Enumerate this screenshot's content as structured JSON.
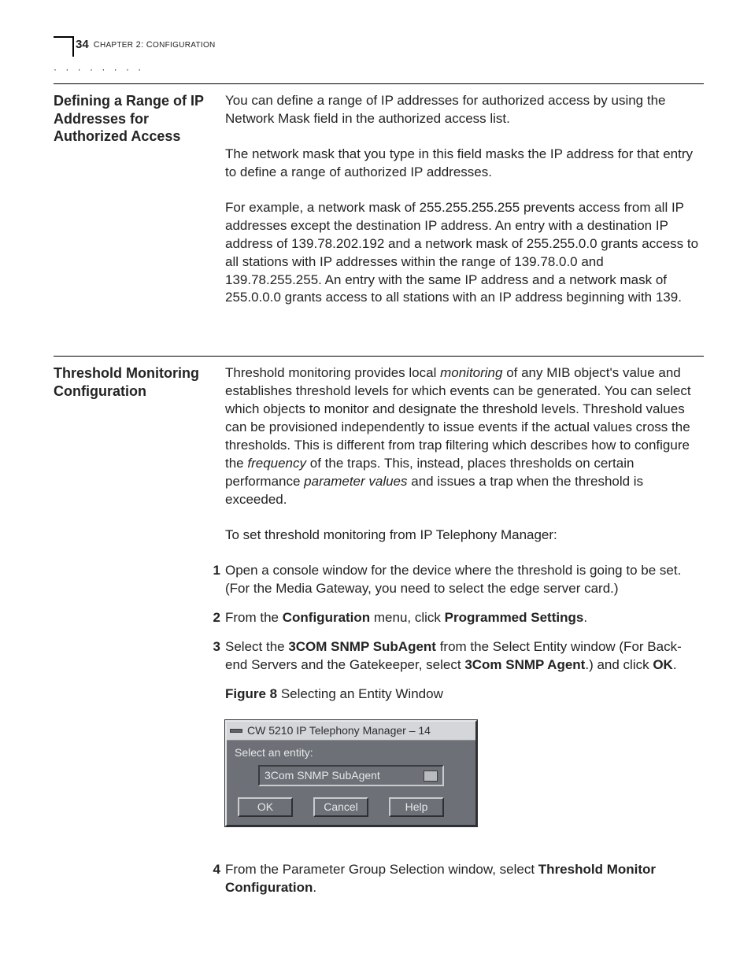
{
  "header": {
    "page_number": "34",
    "running_head_prefix": "C",
    "running_head_word1": "HAPTER",
    "running_head_num": " 2: C",
    "running_head_word2": "ONFIGURATION"
  },
  "section1": {
    "heading": "Defining a Range of IP Addresses for Authorized Access",
    "p1": "You can define a range of IP addresses for authorized access by using the Network Mask field in the authorized access list.",
    "p2": "The network mask that you type in this field masks the IP address for that entry to define a range of authorized IP addresses.",
    "p3": "For example, a network mask of 255.255.255.255 prevents access from all IP addresses except the destination IP address. An entry with a destination IP address of 139.78.202.192 and a network mask of 255.255.0.0 grants access to all stations with IP addresses within the range of 139.78.0.0 and 139.78.255.255. An entry with the same IP address and a network mask of 255.0.0.0 grants access to all stations with an IP address beginning with 139."
  },
  "section2": {
    "heading": "Threshold Monitoring Configuration",
    "p1a": "Threshold monitoring provides local ",
    "p1_i1": "monitoring",
    "p1b": " of any MIB object's value and establishes threshold levels for which events can be generated.  You can select which objects to monitor and designate the threshold levels. Threshold values can be provisioned independently to issue events if the actual values cross the thresholds. This is different from trap filtering which describes how to configure the ",
    "p1_i2": "frequency",
    "p1c": " of the traps.  This, instead, places thresholds on certain performance ",
    "p1_i3": "parameter values",
    "p1d": " and issues a trap when the threshold is exceeded.",
    "p2": "To set threshold monitoring from IP Telephony Manager:",
    "steps": {
      "s1": "Open a console window for the device where the threshold is going to be set. (For the Media Gateway, you need to select the edge server card.)",
      "s2a": "From the ",
      "s2b1": "Configuration",
      "s2c": " menu, click ",
      "s2b2": "Programmed Settings",
      "s2d": ".",
      "s3a": "Select the ",
      "s3b1": "3COM SNMP SubAgent",
      "s3c": " from the Select Entity window (For Back-end Servers and the Gatekeeper, select ",
      "s3b2": "3Com SNMP Agent",
      "s3d": ".) and click ",
      "s3b3": "OK",
      "s3e": ".",
      "s4a": "From the Parameter Group Selection window, select ",
      "s4b1": "Threshold Monitor Configuration",
      "s4c": "."
    },
    "figure": {
      "label": "Figure 8",
      "caption": "  Selecting an Entity Window"
    }
  },
  "dialog": {
    "title": "CW 5210 IP Telephony Manager – 14",
    "prompt": "Select an entity:",
    "selected": "3Com SNMP SubAgent",
    "buttons": {
      "ok": "OK",
      "cancel": "Cancel",
      "help": "Help"
    }
  }
}
